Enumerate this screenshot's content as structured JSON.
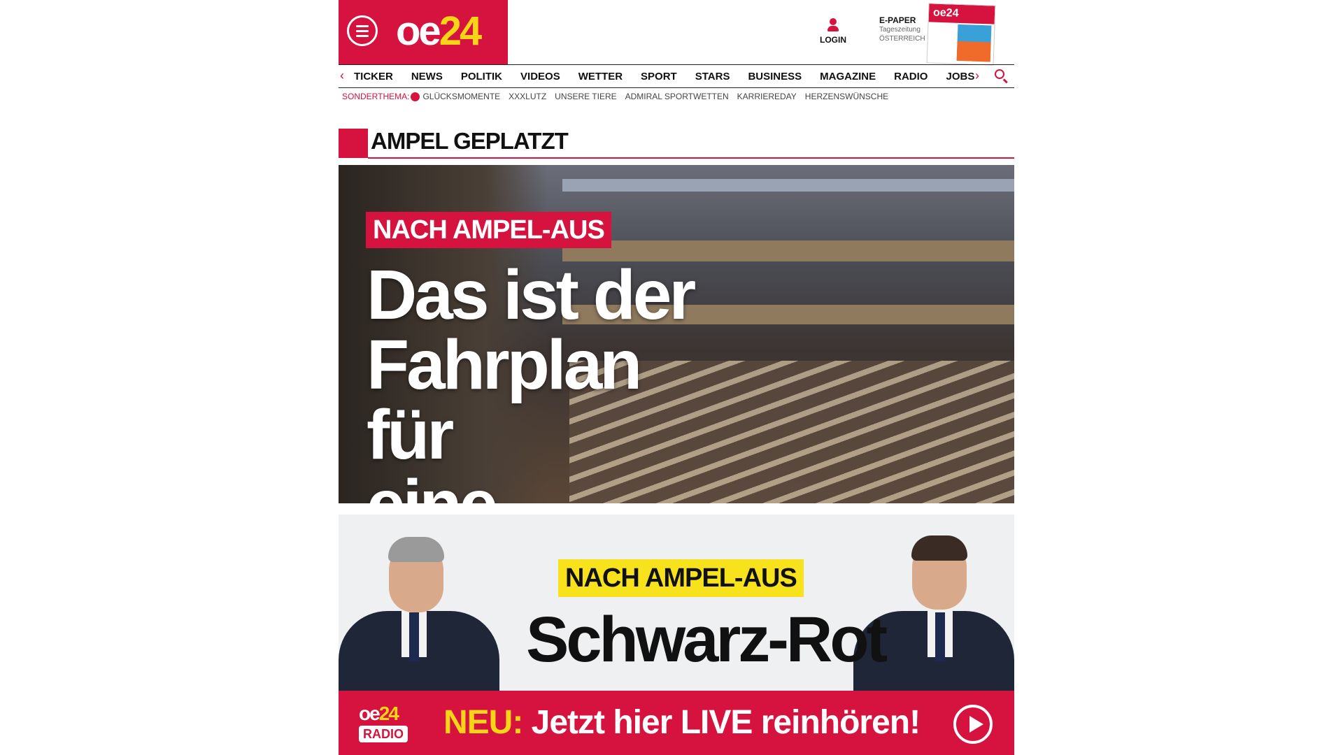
{
  "header": {
    "logo": {
      "main": "oe",
      "accent": "24"
    },
    "login_label": "LOGIN",
    "epaper": {
      "title": "E-PAPER",
      "line1": "Tageszeitung",
      "line2": "ÖSTERREICH",
      "cover_logo": "oe24"
    }
  },
  "nav": {
    "items": [
      "TICKER",
      "NEWS",
      "POLITIK",
      "VIDEOS",
      "WETTER",
      "SPORT",
      "STARS",
      "BUSINESS",
      "MAGAZINE",
      "RADIO",
      "JOBS"
    ],
    "left_arrow": "‹",
    "right_arrow": "›"
  },
  "subnav": {
    "label": "SONDERTHEMA:",
    "links": [
      "GLÜCKSMOMENTE",
      "XXXLUTZ",
      "UNSERE TIERE",
      "ADMIRAL SPORTWETTEN",
      "KARRIEREDAY",
      "HERZENSWÜNSCHE"
    ]
  },
  "section": {
    "title": "AMPEL GEPLATZT"
  },
  "hero1": {
    "kicker": "NACH AMPEL-AUS",
    "title_lines": [
      "Das ist der",
      "Fahrplan für",
      "eine Neuwahl"
    ]
  },
  "hero2": {
    "kicker": "NACH AMPEL-AUS",
    "title": "Schwarz-Rot"
  },
  "radio": {
    "logo_top_main": "oe",
    "logo_top_accent": "24",
    "logo_bottom": "RADIO",
    "neu": "NEU:",
    "text": " Jetzt hier LIVE reinhören!"
  },
  "colors": {
    "brand_red": "#d6133f",
    "accent_yellow": "#f7d417"
  },
  "icons": {
    "menu": "hamburger-icon",
    "user": "user-icon",
    "search": "search-icon",
    "play": "play-icon"
  }
}
